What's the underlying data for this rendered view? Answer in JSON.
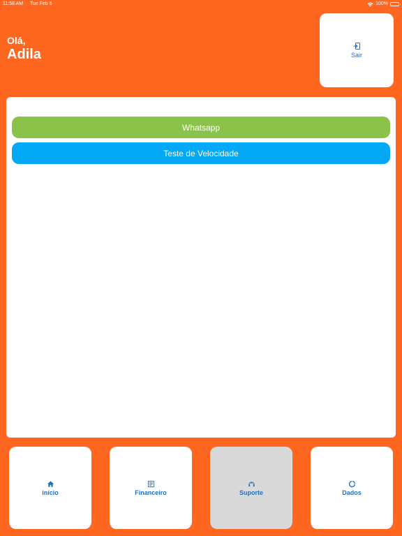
{
  "status_bar": {
    "time": "11:58 AM",
    "date": "Tue Feb 6",
    "battery": "100%"
  },
  "header": {
    "greeting": "Olá,",
    "user_name": "Adila",
    "logout_label": "Sair",
    "logout_icon": "logout-icon"
  },
  "actions": {
    "whatsapp_label": "Whatsapp",
    "speed_test_label": "Teste de Velocidade",
    "whatsapp_color": "#8bc34a",
    "speed_test_color": "#03a9f4"
  },
  "nav": {
    "items": [
      {
        "label": "início",
        "icon": "home-icon",
        "active": false
      },
      {
        "label": "Financeiro",
        "icon": "document-icon",
        "active": false
      },
      {
        "label": "Suporte",
        "icon": "support-icon",
        "active": true
      },
      {
        "label": "Dados",
        "icon": "data-usage-icon",
        "active": false
      }
    ]
  },
  "colors": {
    "background": "#ff6620",
    "accent_blue": "#1f6fc6",
    "active_tab": "#d9d9d9"
  }
}
